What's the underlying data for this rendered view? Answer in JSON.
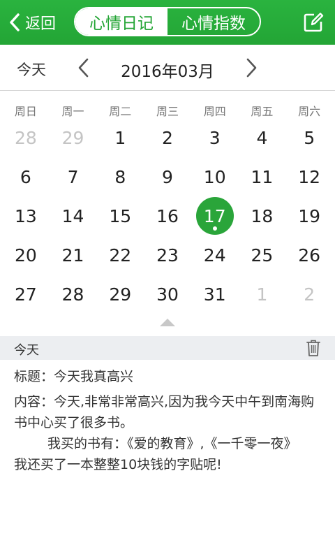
{
  "header": {
    "back_label": "返回",
    "tabs": [
      {
        "label": "心情日记",
        "active": true
      },
      {
        "label": "心情指数",
        "active": false
      }
    ],
    "brand_color": "#2aa53a"
  },
  "month_bar": {
    "today_label": "今天",
    "title": "2016年03月"
  },
  "calendar": {
    "weekdays": [
      "周日",
      "周一",
      "周二",
      "周三",
      "周四",
      "周五",
      "周六"
    ],
    "days": [
      {
        "d": "28",
        "muted": true
      },
      {
        "d": "29",
        "muted": true
      },
      {
        "d": "1"
      },
      {
        "d": "2"
      },
      {
        "d": "3"
      },
      {
        "d": "4"
      },
      {
        "d": "5"
      },
      {
        "d": "6"
      },
      {
        "d": "7"
      },
      {
        "d": "8"
      },
      {
        "d": "9"
      },
      {
        "d": "10"
      },
      {
        "d": "11"
      },
      {
        "d": "12"
      },
      {
        "d": "13"
      },
      {
        "d": "14"
      },
      {
        "d": "15"
      },
      {
        "d": "16"
      },
      {
        "d": "17",
        "selected": true
      },
      {
        "d": "18"
      },
      {
        "d": "19"
      },
      {
        "d": "20"
      },
      {
        "d": "21"
      },
      {
        "d": "22"
      },
      {
        "d": "23"
      },
      {
        "d": "24"
      },
      {
        "d": "25"
      },
      {
        "d": "26"
      },
      {
        "d": "27"
      },
      {
        "d": "28"
      },
      {
        "d": "29"
      },
      {
        "d": "30"
      },
      {
        "d": "31"
      },
      {
        "d": "1",
        "muted": true
      },
      {
        "d": "2",
        "muted": true
      }
    ]
  },
  "section": {
    "title": "今天"
  },
  "entry": {
    "title_line": "标题：今天我真高兴",
    "content_line": "内容：今天,非常非常高兴,因为我今天中午到南海购书中心买了很多书。",
    "books_line": "我买的书有：《爱的教育》,《一千零一夜》",
    "last_line": "我还买了一本整整10块钱的字贴呢!"
  }
}
